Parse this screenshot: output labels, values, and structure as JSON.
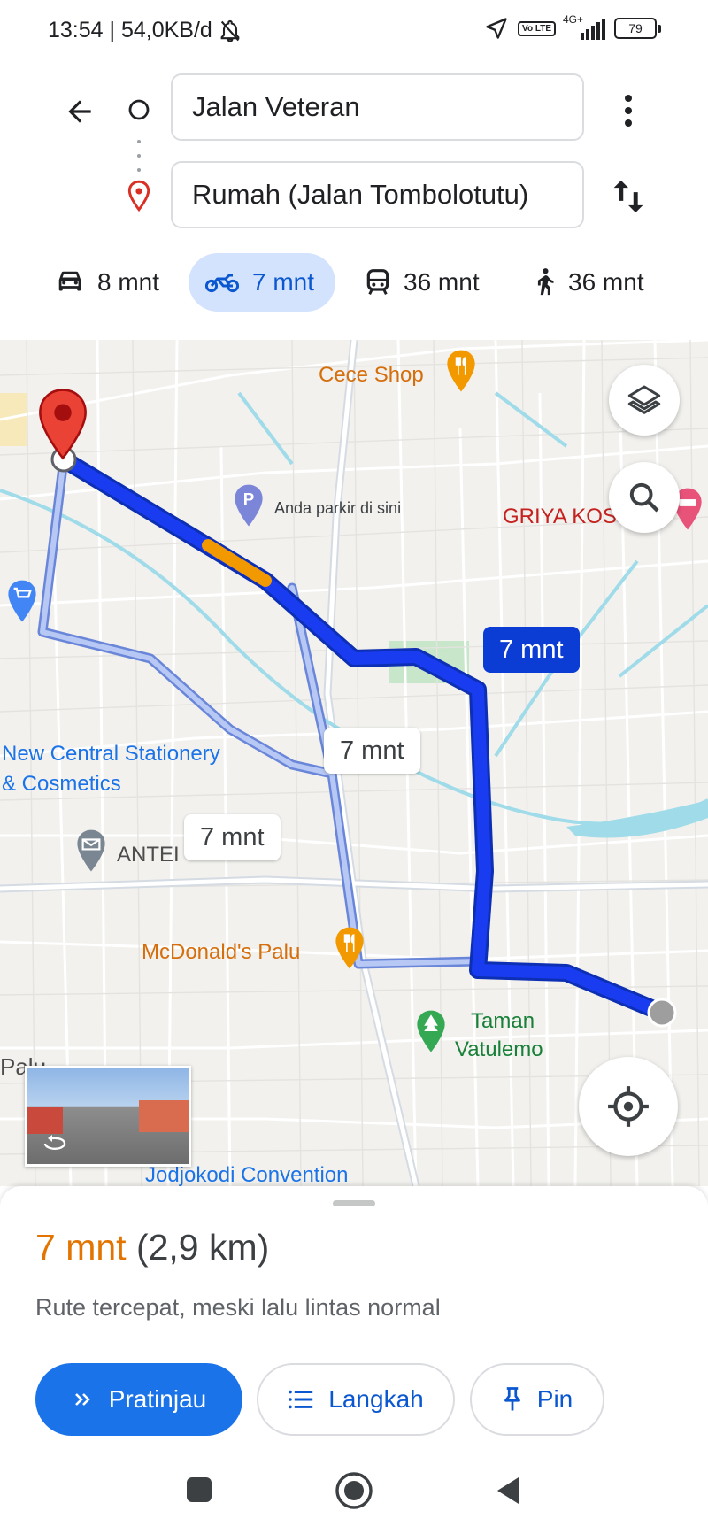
{
  "status": {
    "time_speed": "13:54 | 54,0KB/d",
    "network": "4G+",
    "volte": "Vo LTE",
    "battery": "79"
  },
  "search": {
    "origin": "Jalan Veteran",
    "destination": "Rumah (Jalan Tombolotutu)"
  },
  "modes": [
    {
      "icon": "car-icon",
      "label": "8 mnt",
      "active": false
    },
    {
      "icon": "motorcycle-icon",
      "label": "7 mnt",
      "active": true
    },
    {
      "icon": "transit-icon",
      "label": "36 mnt",
      "active": false
    },
    {
      "icon": "walk-icon",
      "label": "36 mnt",
      "active": false
    }
  ],
  "map": {
    "pois": {
      "cece_shop": "Cece Shop",
      "parking": "Anda parkir di sini",
      "griya": "GRIYA KOS",
      "stationery_line1": "New Central Stationery",
      "stationery_line2": "& Cosmetics",
      "antei": "ANTEI",
      "mcdonalds": "McDonald's Palu",
      "taman_line1": "Taman",
      "taman_line2": "Vatulemo",
      "palu": "Palu",
      "jodjokodi": "Jodjokodi Convention"
    },
    "route_tags": {
      "main": "7 mnt",
      "alt1": "7 mnt",
      "alt2": "7 mnt"
    },
    "colors": {
      "main_route": "#1a3cf0",
      "alt_route": "#a8bff5",
      "traffic": "#f29900"
    }
  },
  "sheet": {
    "eta_time": "7 mnt",
    "eta_distance": "(2,9 km)",
    "summary": "Rute tercepat, meski lalu lintas normal",
    "buttons": {
      "preview": "Pratinjau",
      "steps": "Langkah",
      "pin": "Pin"
    }
  }
}
